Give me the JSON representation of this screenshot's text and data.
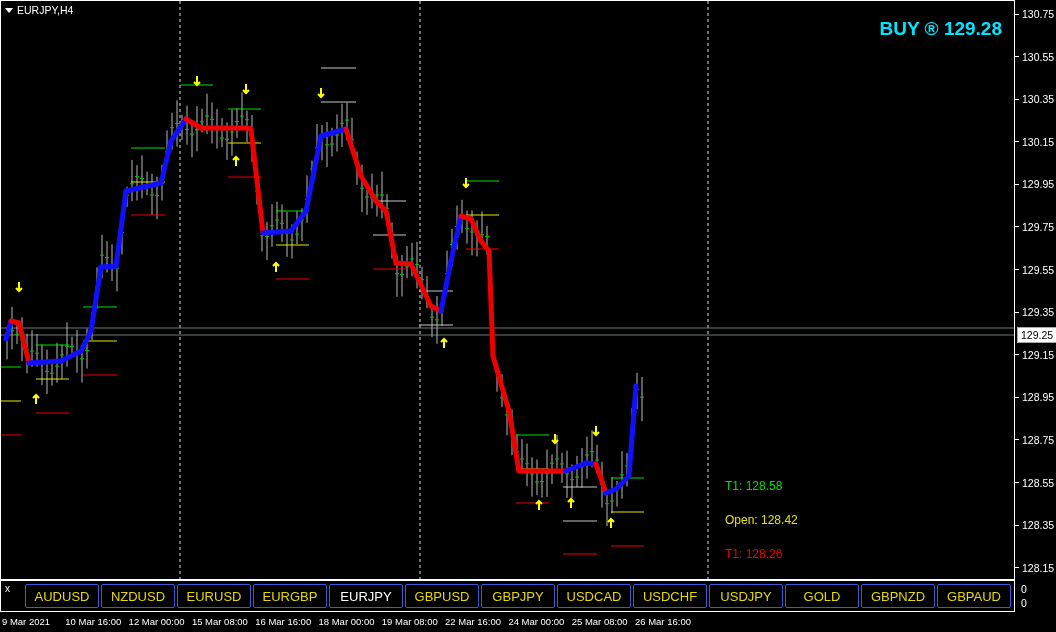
{
  "chart": {
    "symbol": "EURJPY,H4",
    "signal": "BUY ® 129.28",
    "targets": [
      {
        "label": "T1: 128.58",
        "color": "#00e000"
      },
      {
        "label": "Open: 128.42",
        "color": "#e6e600"
      },
      {
        "label": "T1: 128.26",
        "color": "#ee0000"
      }
    ],
    "price_axis": [
      "130.75",
      "130.55",
      "130.35",
      "130.15",
      "129.95",
      "129.75",
      "129.55",
      "129.35",
      "129.15",
      "128.95",
      "128.75",
      "128.55",
      "128.35",
      "128.15"
    ],
    "current_price": "129.25"
  },
  "symbol_panel": {
    "close": "x",
    "buttons": [
      {
        "label": "AUDUSD",
        "selected": false
      },
      {
        "label": "NZDUSD",
        "selected": false
      },
      {
        "label": "EURUSD",
        "selected": false
      },
      {
        "label": "EURGBP",
        "selected": false
      },
      {
        "label": "EURJPY",
        "selected": true
      },
      {
        "label": "GBPUSD",
        "selected": false
      },
      {
        "label": "GBPJPY",
        "selected": false
      },
      {
        "label": "USDCAD",
        "selected": false
      },
      {
        "label": "USDCHF",
        "selected": false
      },
      {
        "label": "USDJPY",
        "selected": false
      },
      {
        "label": "GOLD",
        "selected": false
      },
      {
        "label": "GBPNZD",
        "selected": false
      },
      {
        "label": "GBPAUD",
        "selected": false
      }
    ],
    "axis": [
      "0",
      "0"
    ]
  },
  "time_axis": [
    "9 Mar 2021",
    "10 Mar 16:00",
    "12 Mar 00:00",
    "15 Mar 08:00",
    "16 Mar 16:00",
    "18 Mar 00:00",
    "19 Mar 08:00",
    "22 Mar 16:00",
    "24 Mar 00:00",
    "25 Mar 08:00",
    "26 Mar 16:00"
  ]
}
